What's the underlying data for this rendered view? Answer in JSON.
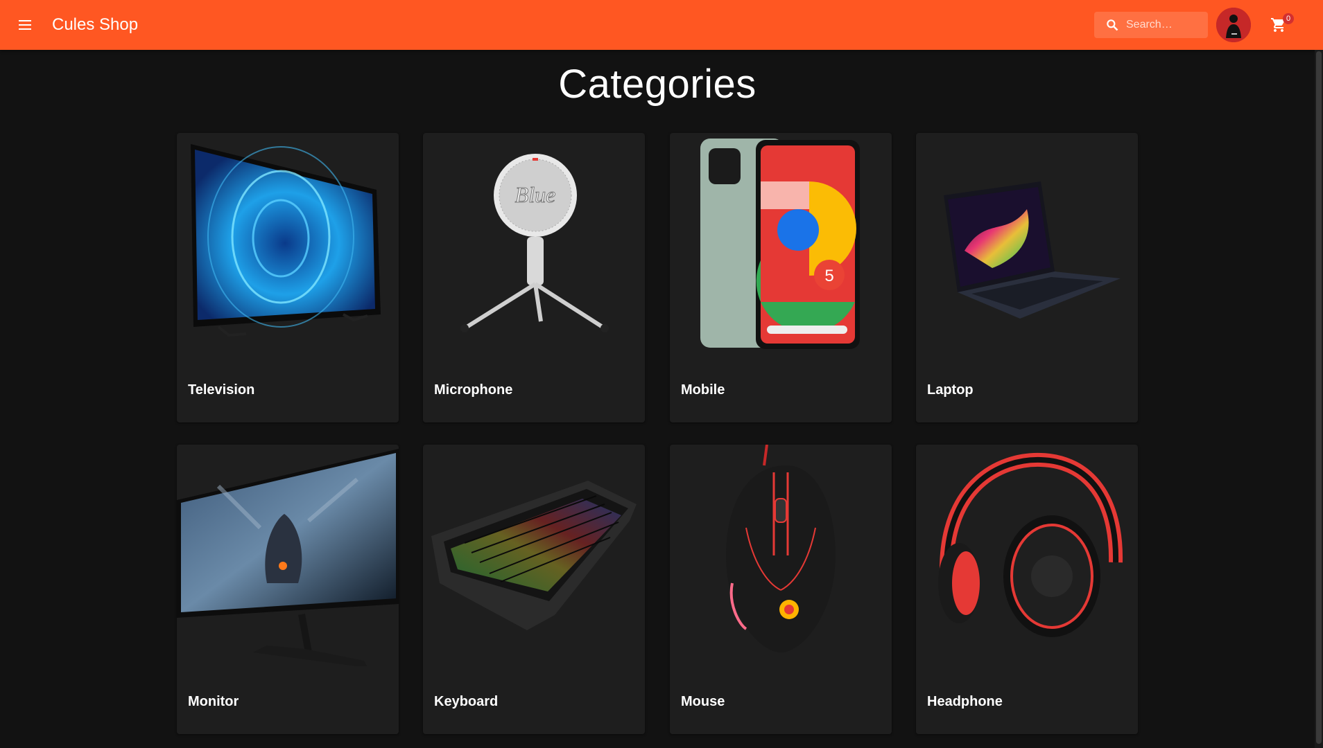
{
  "app": {
    "title": "Cules Shop"
  },
  "search": {
    "placeholder": "Search…"
  },
  "cart": {
    "count": "0"
  },
  "page": {
    "heading": "Categories"
  },
  "categories": [
    {
      "label": "Television",
      "icon": "television-image"
    },
    {
      "label": "Microphone",
      "icon": "microphone-image"
    },
    {
      "label": "Mobile",
      "icon": "mobile-phone-image"
    },
    {
      "label": "Laptop",
      "icon": "laptop-image"
    },
    {
      "label": "Monitor",
      "icon": "monitor-image"
    },
    {
      "label": "Keyboard",
      "icon": "keyboard-image"
    },
    {
      "label": "Mouse",
      "icon": "mouse-image"
    },
    {
      "label": "Headphone",
      "icon": "headphone-image"
    }
  ],
  "colors": {
    "appbar": "#ff5722",
    "background": "#121212",
    "card": "#1e1e1e"
  }
}
